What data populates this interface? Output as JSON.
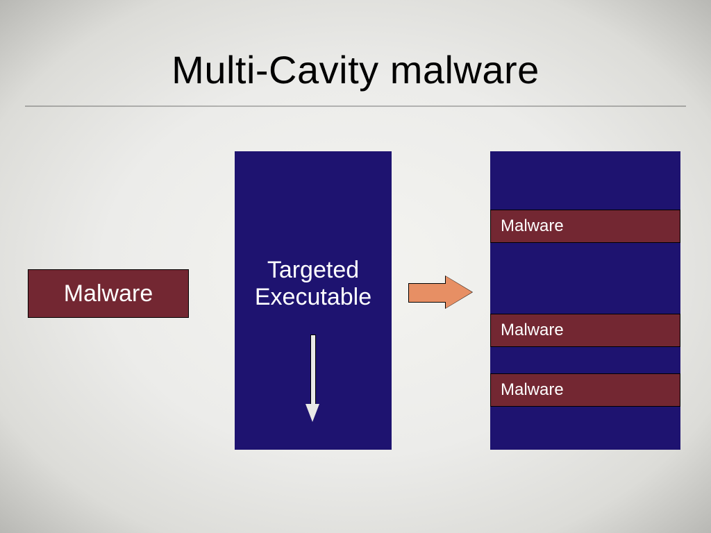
{
  "title": "Multi-Cavity malware",
  "left_box": {
    "label": "Malware"
  },
  "center_box": {
    "line1": "Targeted",
    "line2": "Executable"
  },
  "right_column": {
    "segments": [
      {
        "kind": "navy",
        "label": ""
      },
      {
        "kind": "maroon",
        "label": "Malware"
      },
      {
        "kind": "navy",
        "label": ""
      },
      {
        "kind": "maroon",
        "label": "Malware"
      },
      {
        "kind": "navy",
        "label": ""
      },
      {
        "kind": "maroon",
        "label": "Malware"
      },
      {
        "kind": "navy",
        "label": ""
      }
    ]
  }
}
